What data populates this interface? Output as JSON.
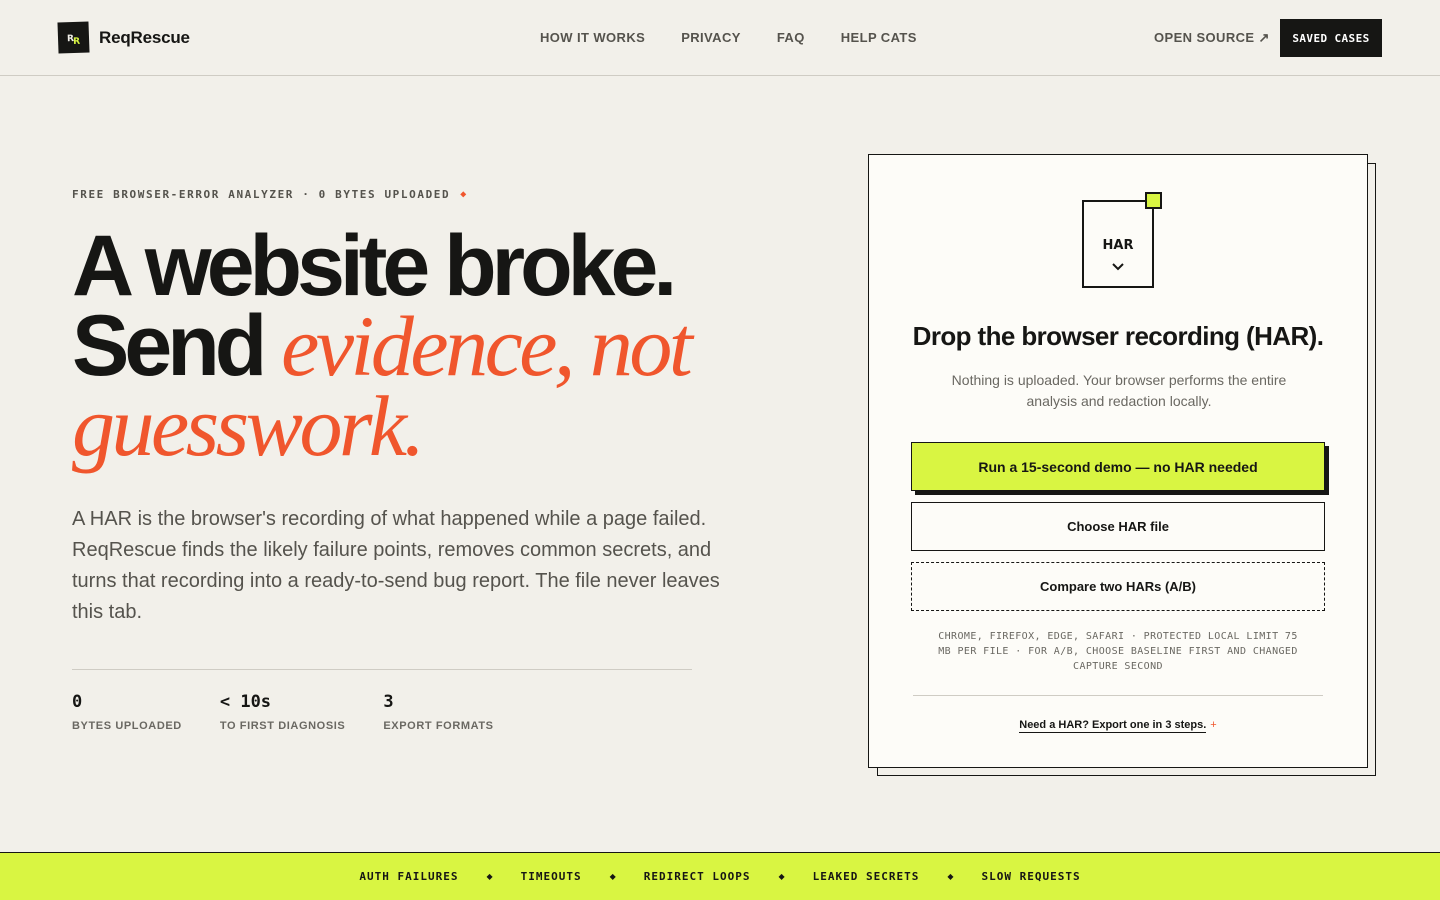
{
  "brand": {
    "name": "ReqRescue",
    "mark_letters": [
      "R",
      "R"
    ]
  },
  "nav": {
    "items": [
      "HOW IT WORKS",
      "PRIVACY",
      "FAQ",
      "HELP CATS"
    ],
    "open_source": "OPEN SOURCE ↗",
    "saved_cases": "SAVED CASES"
  },
  "hero": {
    "eyebrow": "FREE BROWSER-ERROR ANALYZER · 0 BYTES UPLOADED",
    "eyebrow_mark": "◆",
    "headline_line1": "A website broke.",
    "headline_send": "Send ",
    "headline_accent": "evidence, not guesswork.",
    "lede": "A HAR is the browser's recording of what happened while a page failed. ReqRescue finds the likely failure points, removes common secrets, and turns that recording into a ready-to-send bug report. The file never leaves this tab.",
    "stats": [
      {
        "value": "0",
        "label": "BYTES UPLOADED"
      },
      {
        "value": "< 10s",
        "label": "TO FIRST DIAGNOSIS"
      },
      {
        "value": "3",
        "label": "EXPORT FORMATS"
      }
    ]
  },
  "dropzone": {
    "icon_label": "HAR",
    "icon_chevron": "⌄",
    "title": "Drop the browser recording (HAR).",
    "subtitle": "Nothing is uploaded. Your browser performs the entire analysis and redaction locally.",
    "demo_button": "Run a 15-second demo — no HAR needed",
    "choose_button": "Choose HAR file",
    "compare_button": "Compare two HARs (A/B)",
    "note": "CHROME, FIREFOX, EDGE, SAFARI · PROTECTED LOCAL LIMIT 75 MB PER FILE · FOR A/B, CHOOSE BASELINE FIRST AND CHANGED CAPTURE SECOND",
    "help_link": "Need a HAR? Export one in 3 steps.",
    "help_mark": "+"
  },
  "ticker": {
    "items": [
      "AUTH FAILURES",
      "TIMEOUTS",
      "REDIRECT LOOPS",
      "LEAKED SECRETS",
      "SLOW REQUESTS"
    ],
    "separator": "◆"
  },
  "colors": {
    "background": "#f2f0ea",
    "ink": "#161614",
    "accent": "#f0562d",
    "lime": "#d9f542"
  }
}
